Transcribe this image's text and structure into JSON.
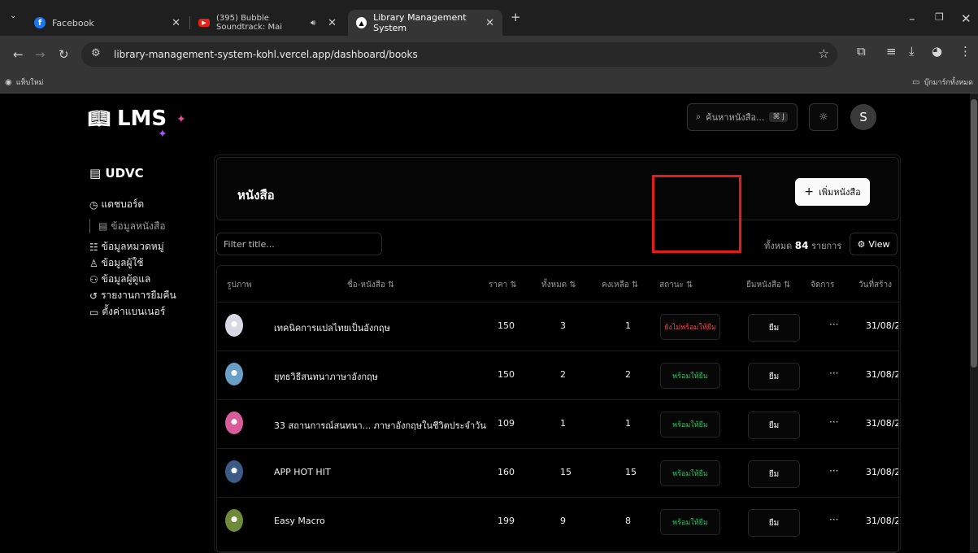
{
  "browser": {
    "tabs": [
      {
        "title": "Facebook",
        "icon": "facebook-icon"
      },
      {
        "title": "(395) Bubble Soundtrack: Mai",
        "icon": "youtube-icon"
      },
      {
        "title": "Library Management System",
        "icon": "vercel-icon"
      }
    ],
    "url": "library-management-system-kohl.vercel.app/dashboard/books",
    "bookmarks_left": "แท็บใหม่",
    "bookmarks_right": "บุ๊กมาร์กทั้งหมด"
  },
  "app": {
    "logo": "LMS",
    "search_placeholder": "ค้นหาหนังสือ...",
    "search_shortcut": "⌘ J",
    "avatar_letter": "S"
  },
  "sidebar": {
    "title": "UDVC",
    "items": [
      {
        "label": "แดชบอร์ด",
        "icon": "clock-icon"
      },
      {
        "label": "ข้อมูลหนังสือ",
        "icon": "file-icon"
      },
      {
        "label": "ข้อมูลหมวดหมู่",
        "icon": "category-icon"
      },
      {
        "label": "ข้อมูลผู้ใช้",
        "icon": "user-icon"
      },
      {
        "label": "ข้อมูลผู้ดูแล",
        "icon": "users-icon"
      },
      {
        "label": "รายงานการยืมคืน",
        "icon": "history-icon"
      },
      {
        "label": "ตั้งค่าแบนเนอร์",
        "icon": "banner-icon"
      }
    ]
  },
  "main": {
    "title": "หนังสือ",
    "add_button": "เพิ่มหนังสือ",
    "filter_placeholder": "Filter title...",
    "total_prefix": "ทั้งหมด",
    "total_count": "84",
    "total_suffix": "รายการ",
    "view_button": "View",
    "columns": [
      "รูปภาพ",
      "ชื่อ-หนังสือ ⇅",
      "ราคา ⇅",
      "ทั้งหมด ⇅",
      "คงเหลือ ⇅",
      "สถานะ ⇅",
      "ยืมหนังสือ ⇅",
      "จัดการ",
      "วันที่สร้าง"
    ],
    "rows": [
      {
        "title": "เทคนิคการแปลไทยเป็นอังกฤษ",
        "price": "150",
        "total": "3",
        "remaining": "1",
        "status": "ยังไม่พร้อมให้ยืม",
        "status_color": "#ef4444",
        "borrow": "ยืม",
        "more": "···",
        "date": "31/08/2",
        "cover": "#d9d9e3"
      },
      {
        "title": "ยุทธวิธีสนทนาภาษาอังกฤษ",
        "price": "150",
        "total": "2",
        "remaining": "2",
        "status": "พร้อมให้ยืม",
        "status_color": "#22c55e",
        "borrow": "ยืม",
        "more": "···",
        "date": "31/08/2",
        "cover": "#6aa0c8"
      },
      {
        "title": "33 สถานการณ์สนทนา... ภาษาอังกฤษในชีวิตประจำวัน",
        "price": "109",
        "total": "1",
        "remaining": "1",
        "status": "พร้อมให้ยืม",
        "status_color": "#22c55e",
        "borrow": "ยืม",
        "more": "···",
        "date": "31/08/2",
        "cover": "#d85b9a"
      },
      {
        "title": "APP HOT HIT",
        "price": "160",
        "total": "15",
        "remaining": "15",
        "status": "พร้อมให้ยืม",
        "status_color": "#22c55e",
        "borrow": "ยืม",
        "more": "···",
        "date": "31/08/2",
        "cover": "#3c5a86"
      },
      {
        "title": "Easy Macro",
        "price": "199",
        "total": "9",
        "remaining": "8",
        "status": "พร้อมให้ยืม",
        "status_color": "#22c55e",
        "borrow": "ยืม",
        "more": "···",
        "date": "31/08/2",
        "cover": "#6f8a3a"
      }
    ]
  }
}
